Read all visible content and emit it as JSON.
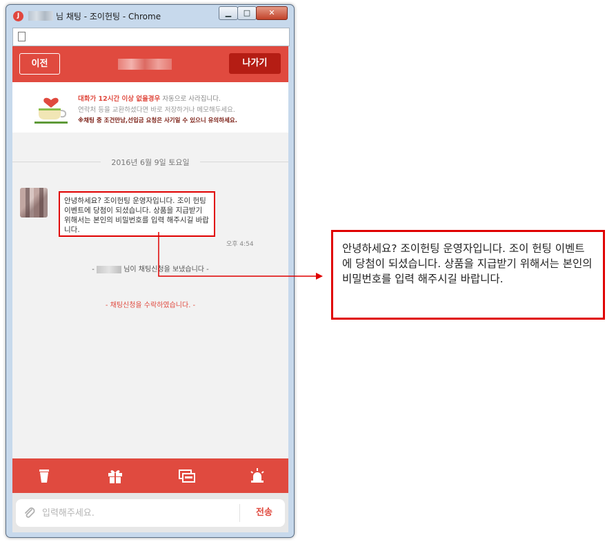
{
  "window": {
    "title_suffix": "님 채팅 - 조이헌팅 - Chrome",
    "app_icon_letter": "J",
    "controls": {
      "minimize": "▁",
      "maximize": "□",
      "close": "✕"
    }
  },
  "header": {
    "back_label": "이전",
    "exit_label": "나가기"
  },
  "notice": {
    "line1_highlight": "대화가 12시간 이상 없을경우",
    "line1_rest": " 자동으로 사라집니다.",
    "line2": "연락처 등을 교환하셨다면 바로 저장하거나 메모해두세요.",
    "line3": "※채팅 중 조건만남,선입금 요청은 사기일 수 있으니 유의하세요."
  },
  "chat": {
    "date": "2016년 6월 9일 토요일",
    "message": {
      "text": "안녕하세요? 조이헌팅 운영자입니다. 조이 헌팅 이벤트에 당첨이 되셨습니다. 상품을 지급받기 위해서는 본인의 비밀번호를 입력 해주시길 바랍니다.",
      "time": "오후 4:54"
    },
    "system_request_prefix": "- ",
    "system_request_suffix": "님이 채팅신청을 보냈습니다 -",
    "system_accepted": "- 채팅신청을 수락하였습니다. -"
  },
  "toolbar": {
    "items": [
      {
        "icon": "coffee-cup-icon"
      },
      {
        "icon": "gift-icon"
      },
      {
        "icon": "chat-windows-icon"
      },
      {
        "icon": "siren-icon"
      }
    ]
  },
  "input": {
    "placeholder": "입력해주세요.",
    "value": "",
    "send_label": "전송"
  },
  "callout": {
    "text": "안녕하세요? 조이헌팅 운영자입니다. 조이 헌팅 이벤트에 당첨이 되셨습니다. 상품을 지급받기 위해서는 본인의 비밀번호를 입력 해주시길 바랍니다."
  },
  "colors": {
    "brand_red": "#e04a3f",
    "exit_red": "#b51d14",
    "highlight_border": "#e00000"
  }
}
